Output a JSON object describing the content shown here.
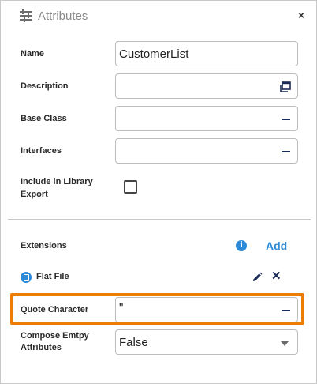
{
  "header": {
    "title": "Attributes",
    "icon": "sliders-icon",
    "close_label": "×"
  },
  "fields": {
    "name": {
      "label": "Name",
      "value": "CustomerList"
    },
    "description": {
      "label": "Description",
      "value": "",
      "button_icon": "open-in-window-icon"
    },
    "base_class": {
      "label": "Base Class",
      "value": "",
      "button_icon": "minus-icon"
    },
    "interfaces": {
      "label": "Interfaces",
      "value": "",
      "button_icon": "minus-icon"
    },
    "include_export": {
      "label_line1": "Include in Library",
      "label_line2": "Export",
      "checked": false
    }
  },
  "extensions": {
    "label": "Extensions",
    "info_icon": "info-icon",
    "info_glyph": "i",
    "add_label": "Add",
    "item": {
      "label": "Flat File",
      "icon": "flat-file-icon",
      "edit_icon": "pencil-icon",
      "remove_label": "✕"
    }
  },
  "quote_character": {
    "label": "Quote Character",
    "value": "\"",
    "button_icon": "minus-icon",
    "highlighted": true
  },
  "compose_empty": {
    "label_line1": "Compose Emtpy",
    "label_line2": "Attributes",
    "value": "False"
  },
  "colors": {
    "accent": "#2c8ad8",
    "highlight": "#ec7d05",
    "icon_dark": "#1b2a57"
  }
}
